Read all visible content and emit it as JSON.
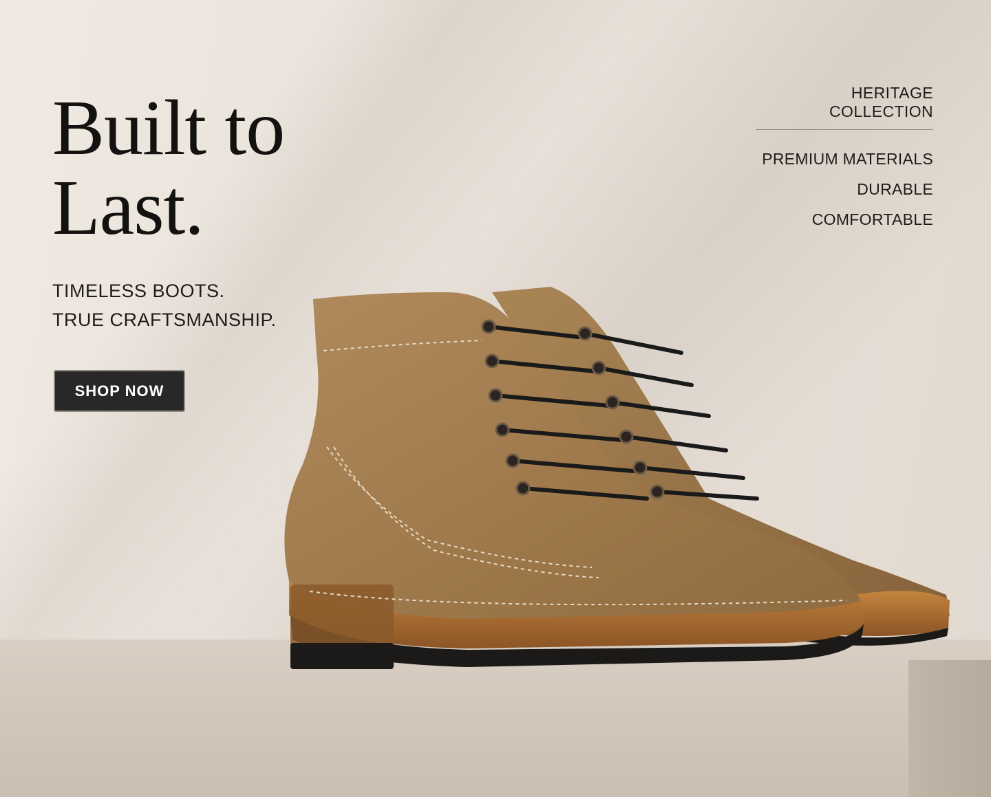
{
  "hero": {
    "headline_line1": "Built to",
    "headline_line2": "Last.",
    "tagline_line1": "TIMELESS BOOTS.",
    "tagline_line2": "TRUE CRAFTSMANSHIP.",
    "cta_label": "SHOP NOW"
  },
  "collection": {
    "title": "HERITAGE COLLECTION",
    "features": [
      "PREMIUM MATERIALS",
      "DURABLE",
      "COMFORTABLE"
    ]
  },
  "colors": {
    "background": "#e8e1d9",
    "text": "#141210",
    "button": "#2a2826",
    "suede": "#a67f52"
  }
}
